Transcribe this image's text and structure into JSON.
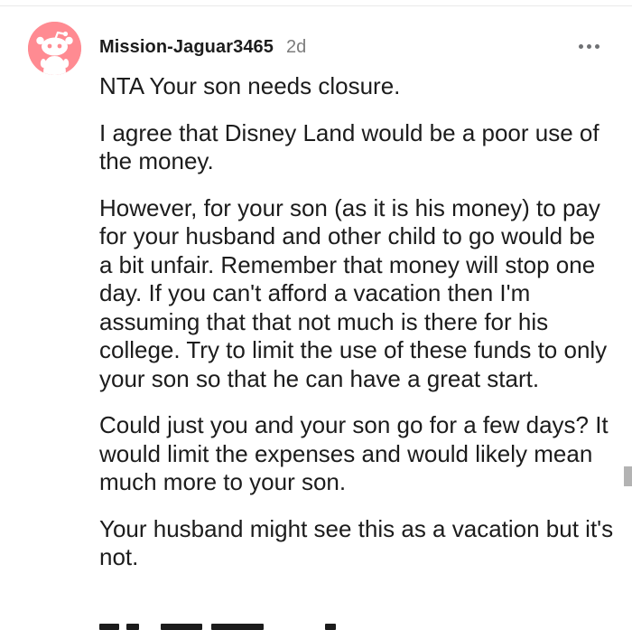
{
  "comment": {
    "username": "Mission-Jaguar3465",
    "age": "2d",
    "avatar_icon": "snoo-avatar-icon",
    "more_icon": "more-options-icon",
    "paragraphs": [
      "NTA Your son needs closure.",
      "I agree that Disney Land would be a poor use of the money.",
      "However, for your son (as it is his money) to pay for your husband and other child to go would be a bit unfair. Remember that money will stop one day. If you can't afford a vacation then I'm assuming that that not much is there for his college. Try to limit the use of these funds to only your son so that he can have a great start.",
      "Could just you and your son go for a few days? It would limit the expenses and would likely mean much more to your son.",
      "Your husband might see this as a vacation but it's not."
    ]
  },
  "colors": {
    "avatar_bg": "#ff8b92",
    "text": "#1c1c1c",
    "muted": "#7c7c7c"
  }
}
